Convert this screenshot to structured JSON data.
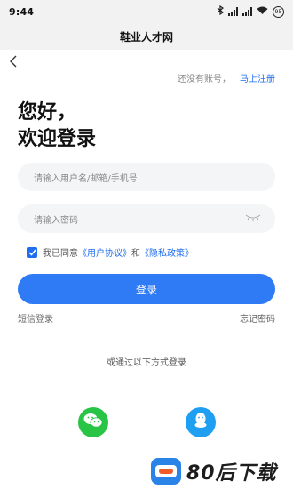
{
  "status_bar": {
    "time": "9:44",
    "battery": "95"
  },
  "header": {
    "title": "鞋业人才网"
  },
  "register": {
    "prompt": "还没有账号，",
    "link": "马上注册"
  },
  "greeting": {
    "line1": "您好，",
    "line2": "欢迎登录"
  },
  "form": {
    "username_placeholder": "请输入用户名/邮箱/手机号",
    "password_placeholder": "请输入密码",
    "agree_prefix": "我已同意",
    "user_agreement": "《用户协议》",
    "and": "和",
    "privacy_policy": "《隐私政策》",
    "agreed": true,
    "login_label": "登录",
    "sms_login": "短信登录",
    "forgot_password": "忘记密码"
  },
  "alt_login": {
    "text": "或通过以下方式登录",
    "options": [
      "wechat-icon",
      "qq-icon"
    ]
  },
  "watermark": {
    "text": "80后下载"
  },
  "colors": {
    "accent": "#2f7af5",
    "wechat": "#28c445",
    "qq": "#1e9ff2"
  }
}
